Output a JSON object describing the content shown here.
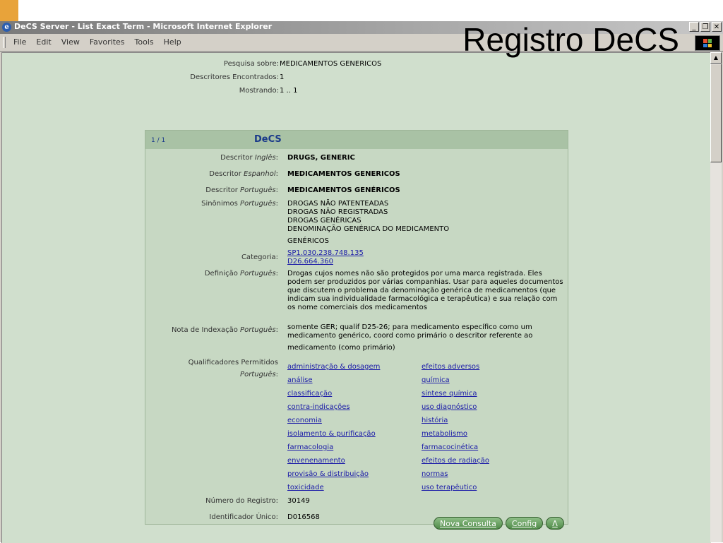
{
  "slide": {
    "title": "Registro DeCS"
  },
  "window": {
    "title": "DeCS Server - List Exact Term - Microsoft Internet Explorer",
    "controls": [
      "_",
      "❐",
      "✕"
    ]
  },
  "menu": [
    "File",
    "Edit",
    "View",
    "Favorites",
    "Tools",
    "Help"
  ],
  "summary": {
    "search_label": "Pesquisa sobre:",
    "search_value": "MEDICAMENTOS GENERICOS",
    "found_label": "Descritores Encontrados:",
    "found_value": "1",
    "showing_label": "Mostrando:",
    "showing_value": "1 .. 1"
  },
  "record": {
    "count": "1 / 1",
    "name": "DeCS",
    "desc_en_label": "Descritor ",
    "desc_en_lang": "Inglês",
    "desc_en": "DRUGS, GENERIC",
    "desc_es_label": "Descritor ",
    "desc_es_lang": "Espanhol",
    "desc_es": "MEDICAMENTOS GENERICOS",
    "desc_pt_label": "Descritor ",
    "desc_pt_lang": "Português",
    "desc_pt": "MEDICAMENTOS GENÉRICOS",
    "syn_label": "Sinônimos ",
    "syn_lang": "Português",
    "synonyms": [
      "DROGAS NÃO PATENTEADAS",
      "DROGAS NÃO REGISTRADAS",
      "DROGAS GENÉRICAS",
      "DENOMINAÇÃO GENÉRICA DO MEDICAMENTO",
      "GENÉRICOS"
    ],
    "cat_label": "Categoria:",
    "categories": [
      "SP1.030.238.748.135",
      "D26.664.360"
    ],
    "def_label": "Definição ",
    "def_lang": "Português",
    "definition": "Drogas cujos nomes não são protegidos por uma marca registrada. Eles podem ser produzidos por várias companhias. Usar para aqueles documentos que discutem o problema da denominação genérica de medicamentos (que indicam sua individualidade farmacológica e terapêutica) e sua relação com os nome comerciais dos medicamentos",
    "note_label": "Nota de Indexação ",
    "note_lang": "Português",
    "note_1": "somente GER; qualif D25-26; para medicamento específico como um medicamento genérico, coord como primário o descritor referente ao",
    "note_2": "medicamento (como primário)",
    "qual_label": "Qualificadores Permitidos",
    "qual_lang": "Português",
    "qualifiers": [
      "administração & dosagem",
      "efeitos adversos",
      "análise",
      "química",
      "classificação",
      "síntese química",
      "contra-indicações",
      "uso diagnóstico",
      "economia",
      "história",
      "isolamento & purificação",
      "metabolismo",
      "farmacologia",
      "farmacocinética",
      "envenenamento",
      "efeitos de radiação",
      "provisão & distribuição",
      "normas",
      "toxicidade",
      "uso terapêutico"
    ],
    "reg_label": "Número do Registro:",
    "reg_value": "30149",
    "uid_label": "Identificador Único:",
    "uid_value": "D016568"
  },
  "buttons": {
    "new_search": "Nova Consulta",
    "config": "Config",
    "up": "Λ"
  },
  "colors": {
    "page_bg": "#d0dfcd",
    "panel_bg": "#c7d8c3",
    "panel_head": "#a9c2a5",
    "link": "#1a1aa8",
    "button": "#4f8a48"
  }
}
